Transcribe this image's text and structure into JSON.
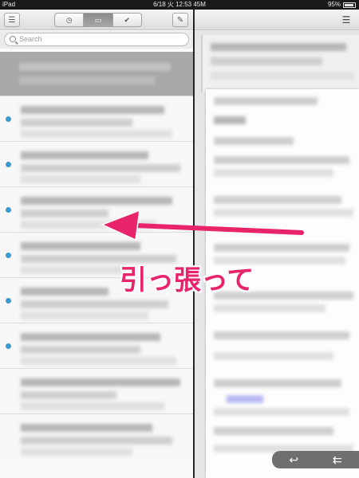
{
  "status_bar": {
    "device": "iPad",
    "datetime": "6/18 火 12:53 45M",
    "battery": "95%"
  },
  "left_pane": {
    "search_placeholder": "Search",
    "toolbar_icons": [
      "menu-icon",
      "clock-icon",
      "inbox-icon",
      "check-icon",
      "compose-icon"
    ],
    "unread_color": "#3d9ad1"
  },
  "right_pane": {
    "toolbar_icons": [
      "menu-icon"
    ],
    "reply_icons": [
      "reply-icon",
      "reply-all-icon"
    ]
  },
  "annotation": {
    "text": "引っ張って",
    "color": "#e8246a"
  }
}
